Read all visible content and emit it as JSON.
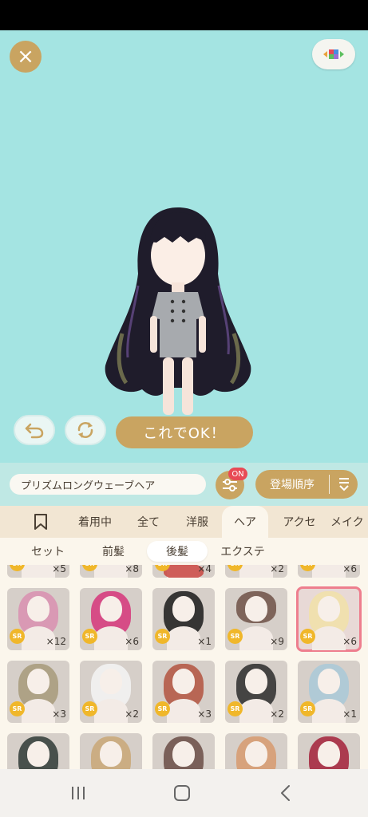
{
  "stage": {
    "background": "#a4e4e2",
    "close_icon": "×",
    "ok_label": "これでOK！"
  },
  "info": {
    "item_name": "プリズムロングウェーブヘア",
    "filter_badge": "ON",
    "sort_label": "登場順序"
  },
  "tabs": [
    {
      "label": ""
    },
    {
      "label": "着用中"
    },
    {
      "label": "全て"
    },
    {
      "label": "洋服"
    },
    {
      "label": "ヘア"
    },
    {
      "label": "アクセ"
    },
    {
      "label": "メイク"
    }
  ],
  "subtabs": [
    {
      "label": "セット"
    },
    {
      "label": "前髪"
    },
    {
      "label": "後髪"
    },
    {
      "label": "エクステ"
    }
  ],
  "items": [
    {
      "badge": "SR",
      "count": "×5"
    },
    {
      "badge": "SR",
      "count": "×8"
    },
    {
      "badge": "SR",
      "count": "×4"
    },
    {
      "badge": "SR",
      "count": "×2"
    },
    {
      "badge": "SR",
      "count": "×6"
    },
    {
      "badge": "SR",
      "count": "×12"
    },
    {
      "badge": "SR",
      "count": "×6"
    },
    {
      "badge": "SR",
      "count": "×1"
    },
    {
      "badge": "SR",
      "count": "×9"
    },
    {
      "badge": "SR",
      "count": "×6"
    },
    {
      "badge": "SR",
      "count": "×3"
    },
    {
      "badge": "SR",
      "count": "×2"
    },
    {
      "badge": "SR",
      "count": "×3"
    },
    {
      "badge": "SR",
      "count": "×2"
    },
    {
      "badge": "SR",
      "count": "×1"
    },
    {
      "badge": "",
      "count": ""
    },
    {
      "badge": "",
      "count": ""
    },
    {
      "badge": "",
      "count": ""
    },
    {
      "badge": "",
      "count": ""
    },
    {
      "badge": "",
      "count": ""
    }
  ],
  "colors": {
    "gold": "#c9a461",
    "accent_red": "#e84a55",
    "selected_border": "#ee7e8e"
  }
}
